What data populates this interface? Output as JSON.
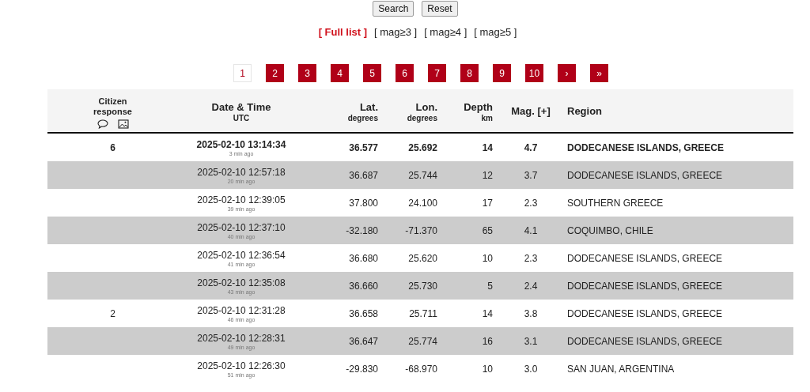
{
  "form_buttons": [
    "Search",
    "Reset"
  ],
  "filters": [
    {
      "label": "[ Full list ]",
      "selected": true
    },
    {
      "label": "[ mag≥3 ]",
      "selected": false
    },
    {
      "label": "[ mag≥4 ]",
      "selected": false
    },
    {
      "label": "[ mag≥5 ]",
      "selected": false
    }
  ],
  "pagination": [
    {
      "label": "1",
      "selected": true
    },
    {
      "label": "2",
      "selected": false
    },
    {
      "label": "3",
      "selected": false
    },
    {
      "label": "4",
      "selected": false
    },
    {
      "label": "5",
      "selected": false
    },
    {
      "label": "6",
      "selected": false
    },
    {
      "label": "7",
      "selected": false
    },
    {
      "label": "8",
      "selected": false
    },
    {
      "label": "9",
      "selected": false
    },
    {
      "label": "10",
      "selected": false
    },
    {
      "label": "›",
      "selected": false
    },
    {
      "label": "»",
      "selected": false
    }
  ],
  "table": {
    "columns": [
      {
        "title": "Citizen response"
      },
      {
        "title": "Date & Time",
        "unit": "UTC"
      },
      {
        "title": "Lat.",
        "unit": "degrees"
      },
      {
        "title": "Lon.",
        "unit": "degrees"
      },
      {
        "title": "Depth",
        "unit": "km"
      },
      {
        "title": "Mag. [+]"
      },
      {
        "title": "Region"
      }
    ],
    "rows": [
      {
        "latest": true,
        "citizen": "6",
        "datetime": "2025-02-10 13:14:34",
        "ago": "3 min ago",
        "lat": "36.577",
        "lon": "25.692",
        "depth": "14",
        "mag": "4.7",
        "region": "DODECANESE ISLANDS, GREECE"
      },
      {
        "latest": false,
        "datetime": "2025-02-10 12:57:18",
        "ago": "20 min ago",
        "lat": "36.687",
        "lon": "25.744",
        "depth": "12",
        "mag": "3.7",
        "region": "DODECANESE ISLANDS, GREECE"
      },
      {
        "latest": false,
        "datetime": "2025-02-10 12:39:05",
        "ago": "39 min ago",
        "lat": "37.800",
        "lon": "24.100",
        "depth": "17",
        "mag": "2.3",
        "region": "SOUTHERN GREECE"
      },
      {
        "latest": false,
        "datetime": "2025-02-10 12:37:10",
        "ago": "40 min ago",
        "lat": "-32.180",
        "lon": "-71.370",
        "depth": "65",
        "mag": "4.1",
        "region": "COQUIMBO, CHILE"
      },
      {
        "latest": false,
        "datetime": "2025-02-10 12:36:54",
        "ago": "41 min ago",
        "lat": "36.680",
        "lon": "25.620",
        "depth": "10",
        "mag": "2.3",
        "region": "DODECANESE ISLANDS, GREECE"
      },
      {
        "latest": false,
        "datetime": "2025-02-10 12:35:08",
        "ago": "43 min ago",
        "lat": "36.660",
        "lon": "25.730",
        "depth": "5",
        "mag": "2.4",
        "region": "DODECANESE ISLANDS, GREECE"
      },
      {
        "latest": false,
        "citizen": "2",
        "datetime": "2025-02-10 12:31:28",
        "ago": "46 min ago",
        "lat": "36.658",
        "lon": "25.711",
        "depth": "14",
        "mag": "3.8",
        "region": "DODECANESE ISLANDS, GREECE"
      },
      {
        "latest": false,
        "datetime": "2025-02-10 12:28:31",
        "ago": "49 min ago",
        "lat": "36.647",
        "lon": "25.774",
        "depth": "16",
        "mag": "3.1",
        "region": "DODECANESE ISLANDS, GREECE"
      },
      {
        "latest": false,
        "datetime": "2025-02-10 12:26:30",
        "ago": "51 min ago",
        "lat": "-29.830",
        "lon": "-68.970",
        "depth": "10",
        "mag": "3.0",
        "region": "SAN JUAN, ARGENTINA"
      }
    ]
  }
}
